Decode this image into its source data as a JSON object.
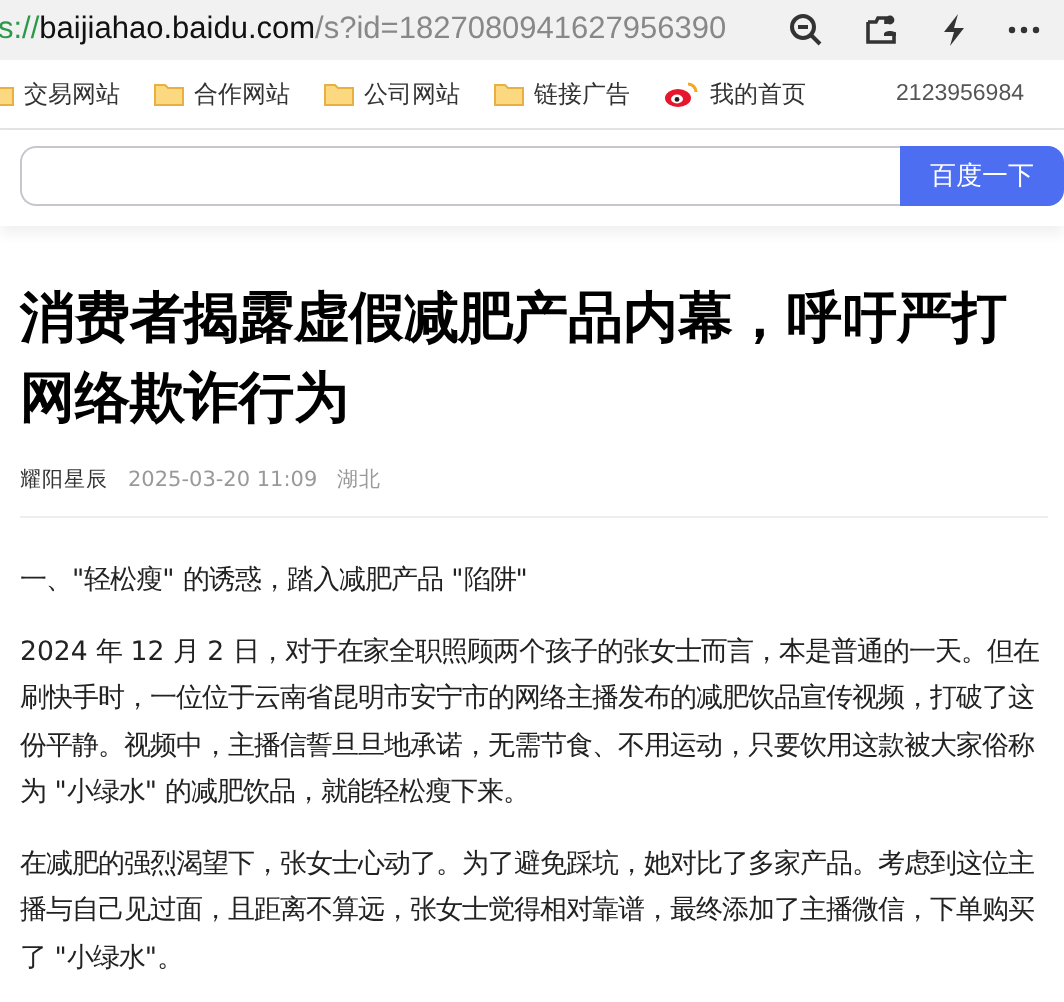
{
  "address_bar": {
    "scheme": "s://",
    "host": "baijiahao.baidu.com",
    "path": "/s?id=1827080941627956390"
  },
  "bookmarks": [
    {
      "label": "交易网站",
      "kind": "folder"
    },
    {
      "label": "合作网站",
      "kind": "folder"
    },
    {
      "label": "公司网站",
      "kind": "folder"
    },
    {
      "label": "链接广告",
      "kind": "folder"
    },
    {
      "label": "我的首页",
      "kind": "weibo"
    }
  ],
  "bookmark_bar_text": "2123956984",
  "search": {
    "button": "百度一下"
  },
  "article": {
    "title": "消费者揭露虚假减肥产品内幕，呼吁严打网络欺诈行为",
    "author": "耀阳星辰",
    "date": "2025-03-20 11:09",
    "location": "湖北",
    "paragraphs": [
      "一、\"轻松瘦\" 的诱惑，踏入减肥产品 \"陷阱\"",
      "2024 年 12 月 2 日，对于在家全职照顾两个孩子的张女士而言，本是普通的一天。但在刷快手时，一位位于云南省昆明市安宁市的网络主播发布的减肥饮品宣传视频，打破了这份平静。视频中，主播信誓旦旦地承诺，无需节食、不用运动，只要饮用这款被大家俗称为 \"小绿水\" 的减肥饮品，就能轻松瘦下来。",
      "在减肥的强烈渴望下，张女士心动了。为了避免踩坑，她对比了多家产品。考虑到这位主播与自己见过面，且距离不算远，张女士觉得相对靠谱，最终添加了主播微信，下单购买了 \"小绿水\"。"
    ]
  }
}
